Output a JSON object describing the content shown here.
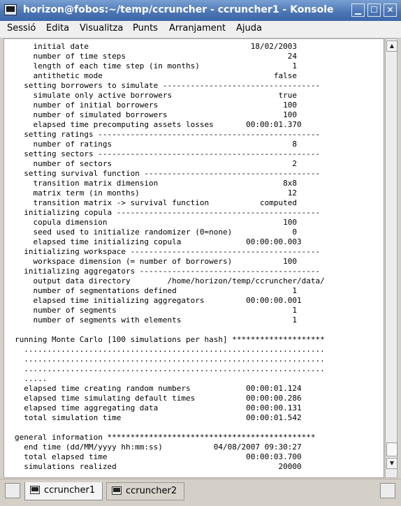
{
  "window": {
    "title": "horizon@fobos:~/temp/ccruncher - ccruncher1 - Konsole",
    "controls": {
      "minimize": "▁",
      "maximize": "☐",
      "close": "✕"
    }
  },
  "menu": [
    "Sessió",
    "Edita",
    "Visualitza",
    "Punts",
    "Arranjament",
    "Ajuda"
  ],
  "terminal": {
    "lines": [
      "    initial date                                   18/02/2003",
      "    number of time steps                                   24",
      "    length of each time step (in months)                    1",
      "    antithetic mode                                     false",
      "  setting borrowers to simulate ----------------------------------",
      "    simulate only active borrowers                       true",
      "    number of initial borrowers                           100",
      "    number of simulated borrowers                         100",
      "    elapsed time precomputing assets losses       00:00:01.370",
      "  setting ratings ------------------------------------------------",
      "    number of ratings                                       8",
      "  setting sectors ------------------------------------------------",
      "    number of sectors                                       2",
      "  setting survival function --------------------------------------",
      "    transition matrix dimension                           8x8",
      "    matrix term (in months)                                12",
      "    transition matrix -> survival function           computed",
      "  initializing copula --------------------------------------------",
      "    copula dimension                                      100",
      "    seed used to initialize randomizer (0=none)             0",
      "    elapsed time initializing copula              00:00:00.003",
      "  initializing workspace -----------------------------------------",
      "    workspace dimension (= number of borrowers)           100",
      "  initializing aggregators ---------------------------------------",
      "    output data directory        /home/horizon/temp/ccruncher/data/",
      "    number of segmentations defined                         1",
      "    elapsed time initializing aggregators         00:00:00.001",
      "    number of segments                                      1",
      "    number of segments with elements                        1",
      "",
      "running Monte Carlo [100 simulations per hash] ********************",
      "  .................................................................",
      "  .................................................................",
      "  .................................................................",
      "  .....",
      "  elapsed time creating random numbers            00:00:01.124",
      "  elapsed time simulating default times           00:00:00.286",
      "  elapsed time aggregating data                   00:00:00.131",
      "  total simulation time                           00:00:01.542",
      "",
      "general information *********************************************",
      "  end time (dd/MM/yyyy hh:mm:ss)           04/08/2007 09:30:27",
      "  total elapsed time                              00:00:03.700",
      "  simulations realized                                   20000"
    ]
  },
  "scrollbar": {
    "up": "▲",
    "down": "▼"
  },
  "tabs": [
    {
      "label": "ccruncher1",
      "active": true
    },
    {
      "label": "ccruncher2",
      "active": false
    }
  ],
  "colors": {
    "titlebar": "#4a74b4",
    "terminal_bg": "#ffffff",
    "terminal_fg": "#000000"
  },
  "icons": {
    "app": "konsole-icon",
    "new_session": "new-session-icon",
    "close_session": "close-session-icon"
  }
}
